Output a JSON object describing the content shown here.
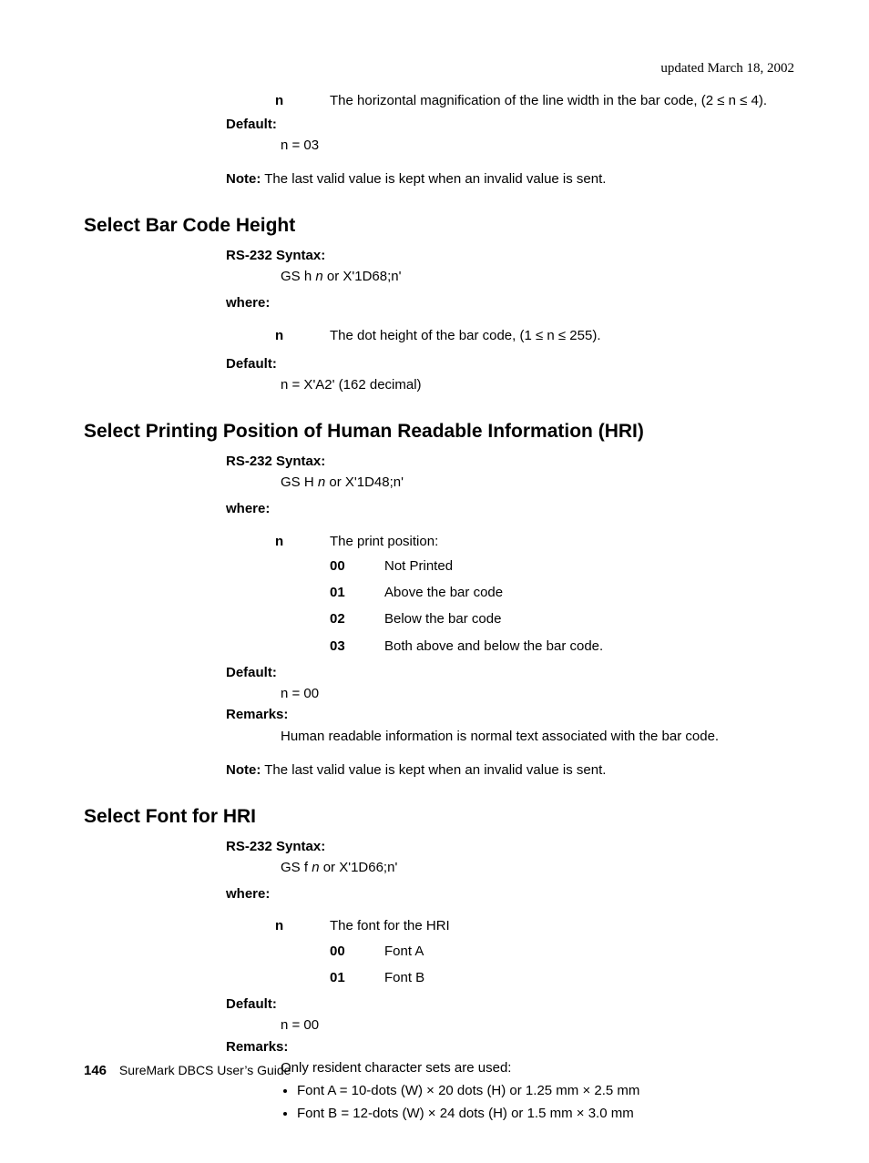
{
  "header": {
    "updated": "updated March 18, 2002"
  },
  "pre": {
    "n_label": "n",
    "n_desc_a": "The horizontal magnification of the line width in the bar code, (2 ≤ n ≤ 4).",
    "default_label": "Default:",
    "default_val": "n = 03",
    "note_label": "Note:",
    "note_text": "The last valid value is kept when an invalid value is sent."
  },
  "s1": {
    "title": "Select Bar Code Height",
    "syntax_label": "RS-232 Syntax:",
    "syntax_val_a": "GS h ",
    "syntax_val_b": "n",
    "syntax_val_c": " or X'1D68;n'",
    "where_label": "where:",
    "n_label": "n",
    "n_desc": "The dot height of the bar code, (1 ≤ n ≤ 255).",
    "default_label": "Default:",
    "default_val": "n = X'A2' (162 decimal)"
  },
  "s2": {
    "title": "Select Printing Position of Human Readable Information (HRI)",
    "syntax_label": "RS-232 Syntax:",
    "syntax_val_a": "GS H ",
    "syntax_val_b": "n",
    "syntax_val_c": " or X'1D48;n'",
    "where_label": "where:",
    "n_label": "n",
    "n_desc": "The print position:",
    "opts": [
      {
        "code": "00",
        "text": "Not Printed"
      },
      {
        "code": "01",
        "text": "Above the bar code"
      },
      {
        "code": "02",
        "text": "Below the bar code"
      },
      {
        "code": "03",
        "text": "Both above and below the bar code."
      }
    ],
    "default_label": "Default:",
    "default_val": "n = 00",
    "remarks_label": "Remarks:",
    "remarks_text": "Human readable information is normal text associated with the bar code.",
    "note_label": "Note:",
    "note_text": "The last valid value is kept when an invalid value is sent."
  },
  "s3": {
    "title": "Select Font for HRI",
    "syntax_label": "RS-232 Syntax:",
    "syntax_val_a": "GS f ",
    "syntax_val_b": "n",
    "syntax_val_c": " or X'1D66;n'",
    "where_label": "where:",
    "n_label": "n",
    "n_desc": "The font for the HRI",
    "opts": [
      {
        "code": "00",
        "text": "Font A"
      },
      {
        "code": "01",
        "text": "Font B"
      }
    ],
    "default_label": "Default:",
    "default_val": "n = 00",
    "remarks_label": "Remarks:",
    "remarks_text": "Only resident character sets are used:",
    "bullets": [
      "Font A = 10-dots (W) × 20 dots (H) or 1.25 mm × 2.5 mm",
      "Font B = 12-dots (W) × 24 dots (H) or 1.5 mm × 3.0 mm"
    ]
  },
  "footer": {
    "pagenum": "146",
    "title": "SureMark DBCS User’s Guide"
  }
}
